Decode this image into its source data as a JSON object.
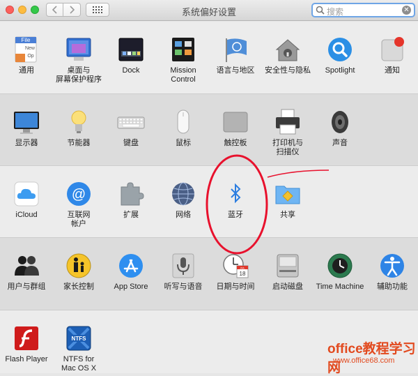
{
  "window": {
    "title": "系统偏好设置"
  },
  "search": {
    "placeholder": "搜索"
  },
  "rows": [
    {
      "items": [
        {
          "name": "general",
          "label": "通用"
        },
        {
          "name": "desktop-screensaver",
          "label": "桌面与\n屏幕保护程序"
        },
        {
          "name": "dock",
          "label": "Dock"
        },
        {
          "name": "mission-control",
          "label": "Mission\nControl"
        },
        {
          "name": "language-region",
          "label": "语言与地区"
        },
        {
          "name": "security-privacy",
          "label": "安全性与隐私"
        },
        {
          "name": "spotlight",
          "label": "Spotlight"
        },
        {
          "name": "notifications",
          "label": "通知"
        }
      ]
    },
    {
      "items": [
        {
          "name": "displays",
          "label": "显示器"
        },
        {
          "name": "energy-saver",
          "label": "节能器"
        },
        {
          "name": "keyboard",
          "label": "键盘"
        },
        {
          "name": "mouse",
          "label": "鼠标"
        },
        {
          "name": "trackpad",
          "label": "触控板"
        },
        {
          "name": "printers-scanners",
          "label": "打印机与\n扫描仪"
        },
        {
          "name": "sound",
          "label": "声音"
        }
      ]
    },
    {
      "items": [
        {
          "name": "icloud",
          "label": "iCloud"
        },
        {
          "name": "internet-accounts",
          "label": "互联网\n帐户"
        },
        {
          "name": "extensions",
          "label": "扩展"
        },
        {
          "name": "network",
          "label": "网络"
        },
        {
          "name": "bluetooth",
          "label": "蓝牙"
        },
        {
          "name": "sharing",
          "label": "共享"
        }
      ]
    },
    {
      "items": [
        {
          "name": "users-groups",
          "label": "用户与群组"
        },
        {
          "name": "parental-controls",
          "label": "家长控制"
        },
        {
          "name": "app-store",
          "label": "App Store"
        },
        {
          "name": "dictation-speech",
          "label": "听写与语音"
        },
        {
          "name": "date-time",
          "label": "日期与时间"
        },
        {
          "name": "startup-disk",
          "label": "启动磁盘"
        },
        {
          "name": "time-machine",
          "label": "Time Machine"
        },
        {
          "name": "accessibility",
          "label": "辅助功能"
        }
      ]
    },
    {
      "items": [
        {
          "name": "flash-player",
          "label": "Flash Player"
        },
        {
          "name": "ntfs",
          "label": "NTFS for\nMac OS X"
        }
      ]
    }
  ],
  "icon_text": {
    "general_file": "File",
    "general_new": "New",
    "general_open": "Op",
    "date_month": "JUL",
    "date_day": "18",
    "ntfs": "NTFS"
  },
  "watermark": {
    "brand": "office教程学习网",
    "url": "www.office68.com"
  },
  "colors": {
    "search_focus": "#6ea5e6",
    "annotation": "#e8112d",
    "accent_blue": "#1e88e5"
  }
}
